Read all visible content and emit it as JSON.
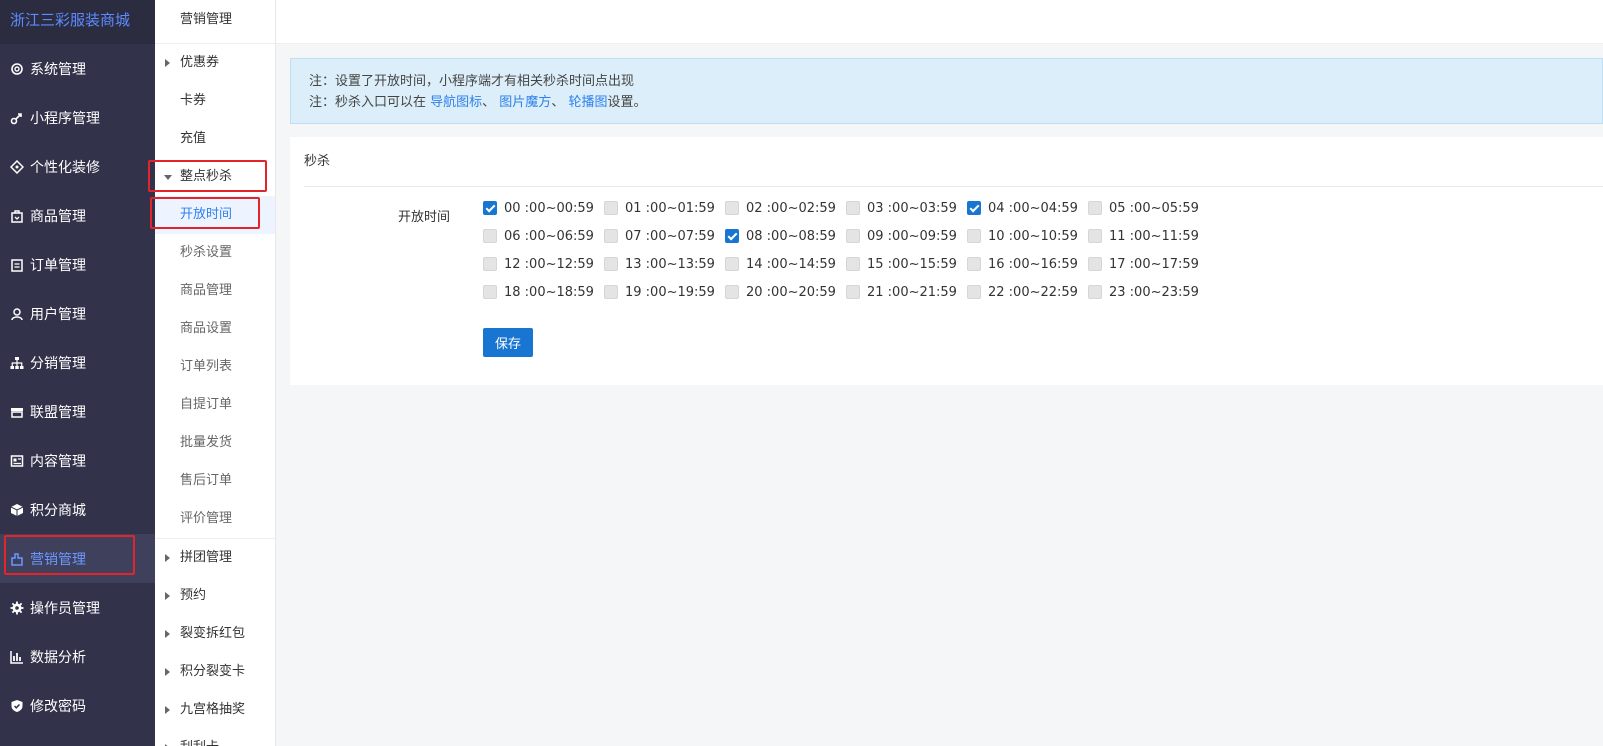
{
  "brand": "浙江三彩服装商城",
  "sidebar": {
    "items": [
      {
        "label": "系统管理",
        "icon": "gear-circle-icon"
      },
      {
        "label": "小程序管理",
        "icon": "link-icon"
      },
      {
        "label": "个性化装修",
        "icon": "diamond-icon"
      },
      {
        "label": "商品管理",
        "icon": "bag-icon"
      },
      {
        "label": "订单管理",
        "icon": "clipboard-icon"
      },
      {
        "label": "用户管理",
        "icon": "user-icon"
      },
      {
        "label": "分销管理",
        "icon": "org-chart-icon"
      },
      {
        "label": "联盟管理",
        "icon": "store-icon"
      },
      {
        "label": "内容管理",
        "icon": "content-icon"
      },
      {
        "label": "积分商城",
        "icon": "cube-icon"
      },
      {
        "label": "营销管理",
        "icon": "marketing-icon"
      },
      {
        "label": "操作员管理",
        "icon": "cog-icon"
      },
      {
        "label": "数据分析",
        "icon": "bar-chart-icon"
      },
      {
        "label": "修改密码",
        "icon": "shield-icon"
      }
    ],
    "active_index": 10
  },
  "submenu": {
    "title": "营销管理",
    "items": [
      {
        "label": "优惠券",
        "type": "group-collapsed"
      },
      {
        "label": "卡券",
        "type": "item"
      },
      {
        "label": "充值",
        "type": "item"
      },
      {
        "label": "整点秒杀",
        "type": "group-expanded"
      },
      {
        "label": "开放时间",
        "type": "child-selected"
      },
      {
        "label": "秒杀设置",
        "type": "child"
      },
      {
        "label": "商品管理",
        "type": "child"
      },
      {
        "label": "商品设置",
        "type": "child"
      },
      {
        "label": "订单列表",
        "type": "child"
      },
      {
        "label": "自提订单",
        "type": "child"
      },
      {
        "label": "批量发货",
        "type": "child"
      },
      {
        "label": "售后订单",
        "type": "child"
      },
      {
        "label": "评价管理",
        "type": "child"
      },
      {
        "label": "拼团管理",
        "type": "group-collapsed"
      },
      {
        "label": "预约",
        "type": "group-collapsed"
      },
      {
        "label": "裂变拆红包",
        "type": "group-collapsed"
      },
      {
        "label": "积分裂变卡",
        "type": "group-collapsed"
      },
      {
        "label": "九宫格抽奖",
        "type": "group-collapsed"
      },
      {
        "label": "刮刮卡",
        "type": "group-collapsed"
      }
    ]
  },
  "notice": {
    "line1": "注：设置了开放时间，小程序端才有相关秒杀时间点出现",
    "line2_prefix": "注：秒杀入口可以在 ",
    "link1": "导航图标",
    "sep1": "、 ",
    "link2": "图片魔方",
    "sep2": "、 ",
    "link3": "轮播图",
    "line2_suffix": "设置。"
  },
  "card": {
    "title": "秒杀",
    "form_label": "开放时间",
    "save_label": "保存",
    "time_slots": [
      {
        "label": "00 :00~00:59",
        "checked": true
      },
      {
        "label": "01 :00~01:59",
        "checked": false
      },
      {
        "label": "02 :00~02:59",
        "checked": false
      },
      {
        "label": "03 :00~03:59",
        "checked": false
      },
      {
        "label": "04 :00~04:59",
        "checked": true
      },
      {
        "label": "05 :00~05:59",
        "checked": false
      },
      {
        "label": "06 :00~06:59",
        "checked": false
      },
      {
        "label": "07 :00~07:59",
        "checked": false
      },
      {
        "label": "08 :00~08:59",
        "checked": true
      },
      {
        "label": "09 :00~09:59",
        "checked": false
      },
      {
        "label": "10 :00~10:59",
        "checked": false
      },
      {
        "label": "11 :00~11:59",
        "checked": false
      },
      {
        "label": "12 :00~12:59",
        "checked": false
      },
      {
        "label": "13 :00~13:59",
        "checked": false
      },
      {
        "label": "14 :00~14:59",
        "checked": false
      },
      {
        "label": "15 :00~15:59",
        "checked": false
      },
      {
        "label": "16 :00~16:59",
        "checked": false
      },
      {
        "label": "17 :00~17:59",
        "checked": false
      },
      {
        "label": "18 :00~18:59",
        "checked": false
      },
      {
        "label": "19 :00~19:59",
        "checked": false
      },
      {
        "label": "20 :00~20:59",
        "checked": false
      },
      {
        "label": "21 :00~21:59",
        "checked": false
      },
      {
        "label": "22 :00~22:59",
        "checked": false
      },
      {
        "label": "23 :00~23:59",
        "checked": false
      }
    ]
  },
  "colors": {
    "sidebar_bg": "#32334a",
    "accent": "#1876d2",
    "highlight": "#e3242b",
    "notice_bg": "#dbeef9"
  }
}
